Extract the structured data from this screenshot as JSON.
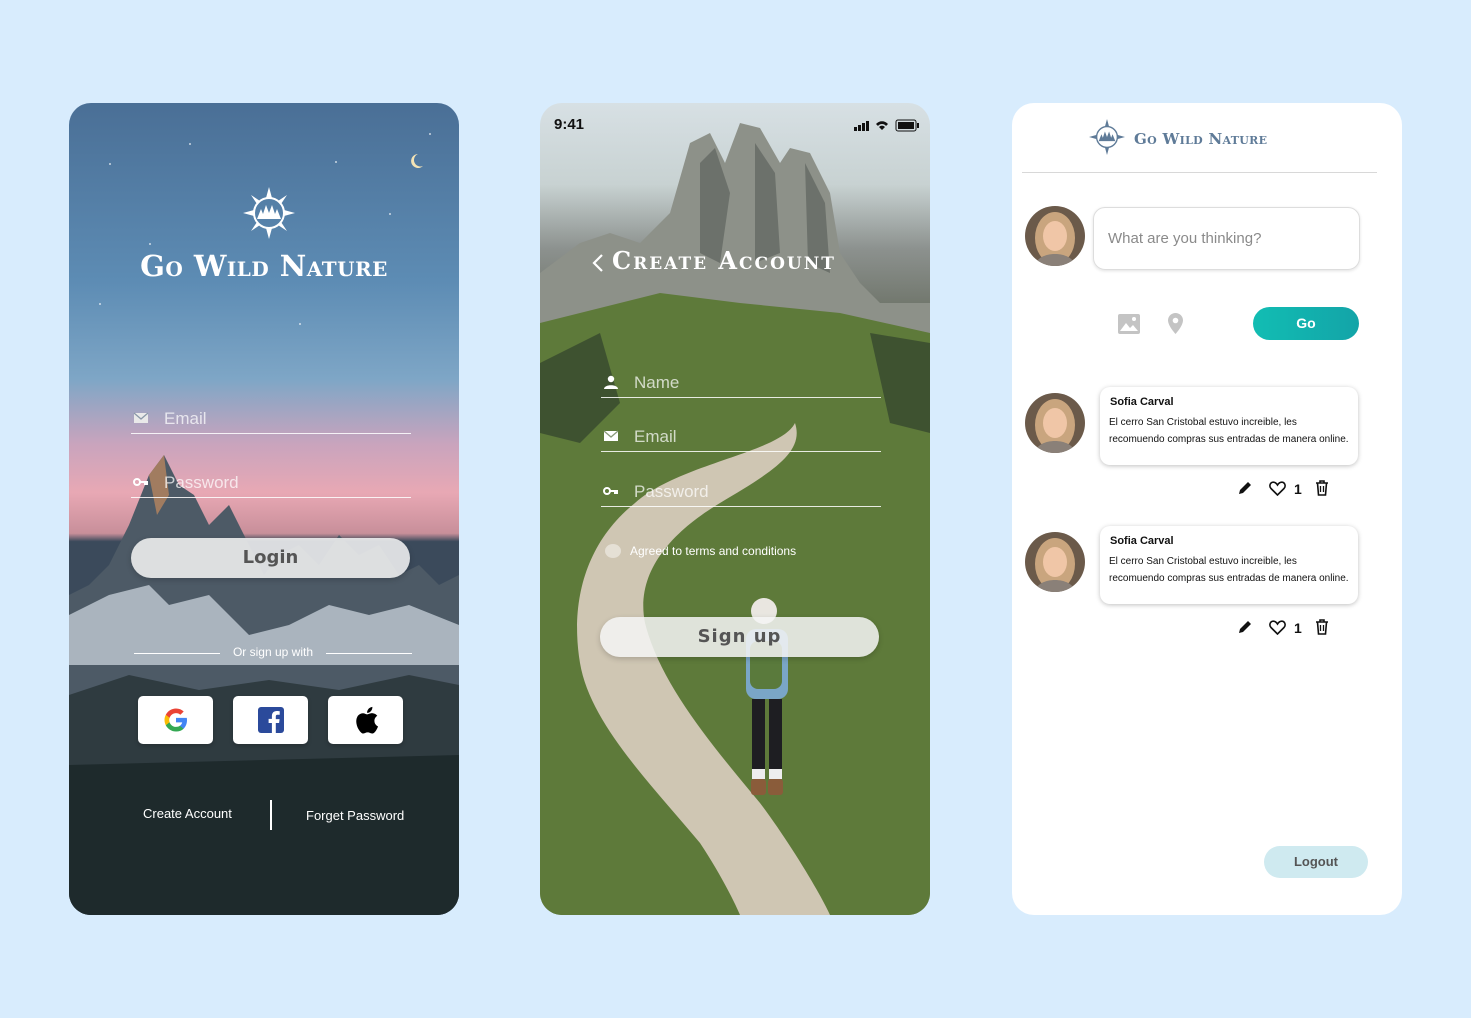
{
  "login_screen": {
    "brand": "Go Wild Nature",
    "email_placeholder": "Email",
    "password_placeholder": "Password",
    "login_label": "Login",
    "divider_text": "Or sign up with",
    "create_account_label": "Create Account",
    "forget_password_label": "Forget Password",
    "social_icons": [
      "google-icon",
      "facebook-icon",
      "apple-icon"
    ]
  },
  "signup_screen": {
    "status_time": "9:41",
    "title": "Create Account",
    "name_placeholder": "Name",
    "email_placeholder": "Email",
    "password_placeholder": "Password",
    "terms_label": "Agreed to terms and conditions",
    "signup_label": "Sign up"
  },
  "feed_screen": {
    "brand": "Go Wild Nature",
    "post_placeholder": "What are you thinking?",
    "go_label": "Go",
    "posts": [
      {
        "author": "Sofia Carval",
        "text": "El cerro San Cristobal estuvo increible, les recomuendo compras sus entradas de manera online.",
        "likes": "1"
      },
      {
        "author": "Sofia Carval",
        "text": "El cerro San Cristobal estuvo increible, les recomuendo compras sus entradas de manera online.",
        "likes": "1"
      }
    ],
    "logout_label": "Logout"
  },
  "colors": {
    "background": "#d8ecfd",
    "go_button": "#12b5b0",
    "logout_button": "#cfeaf0",
    "brand_blue": "#5f7b98"
  }
}
